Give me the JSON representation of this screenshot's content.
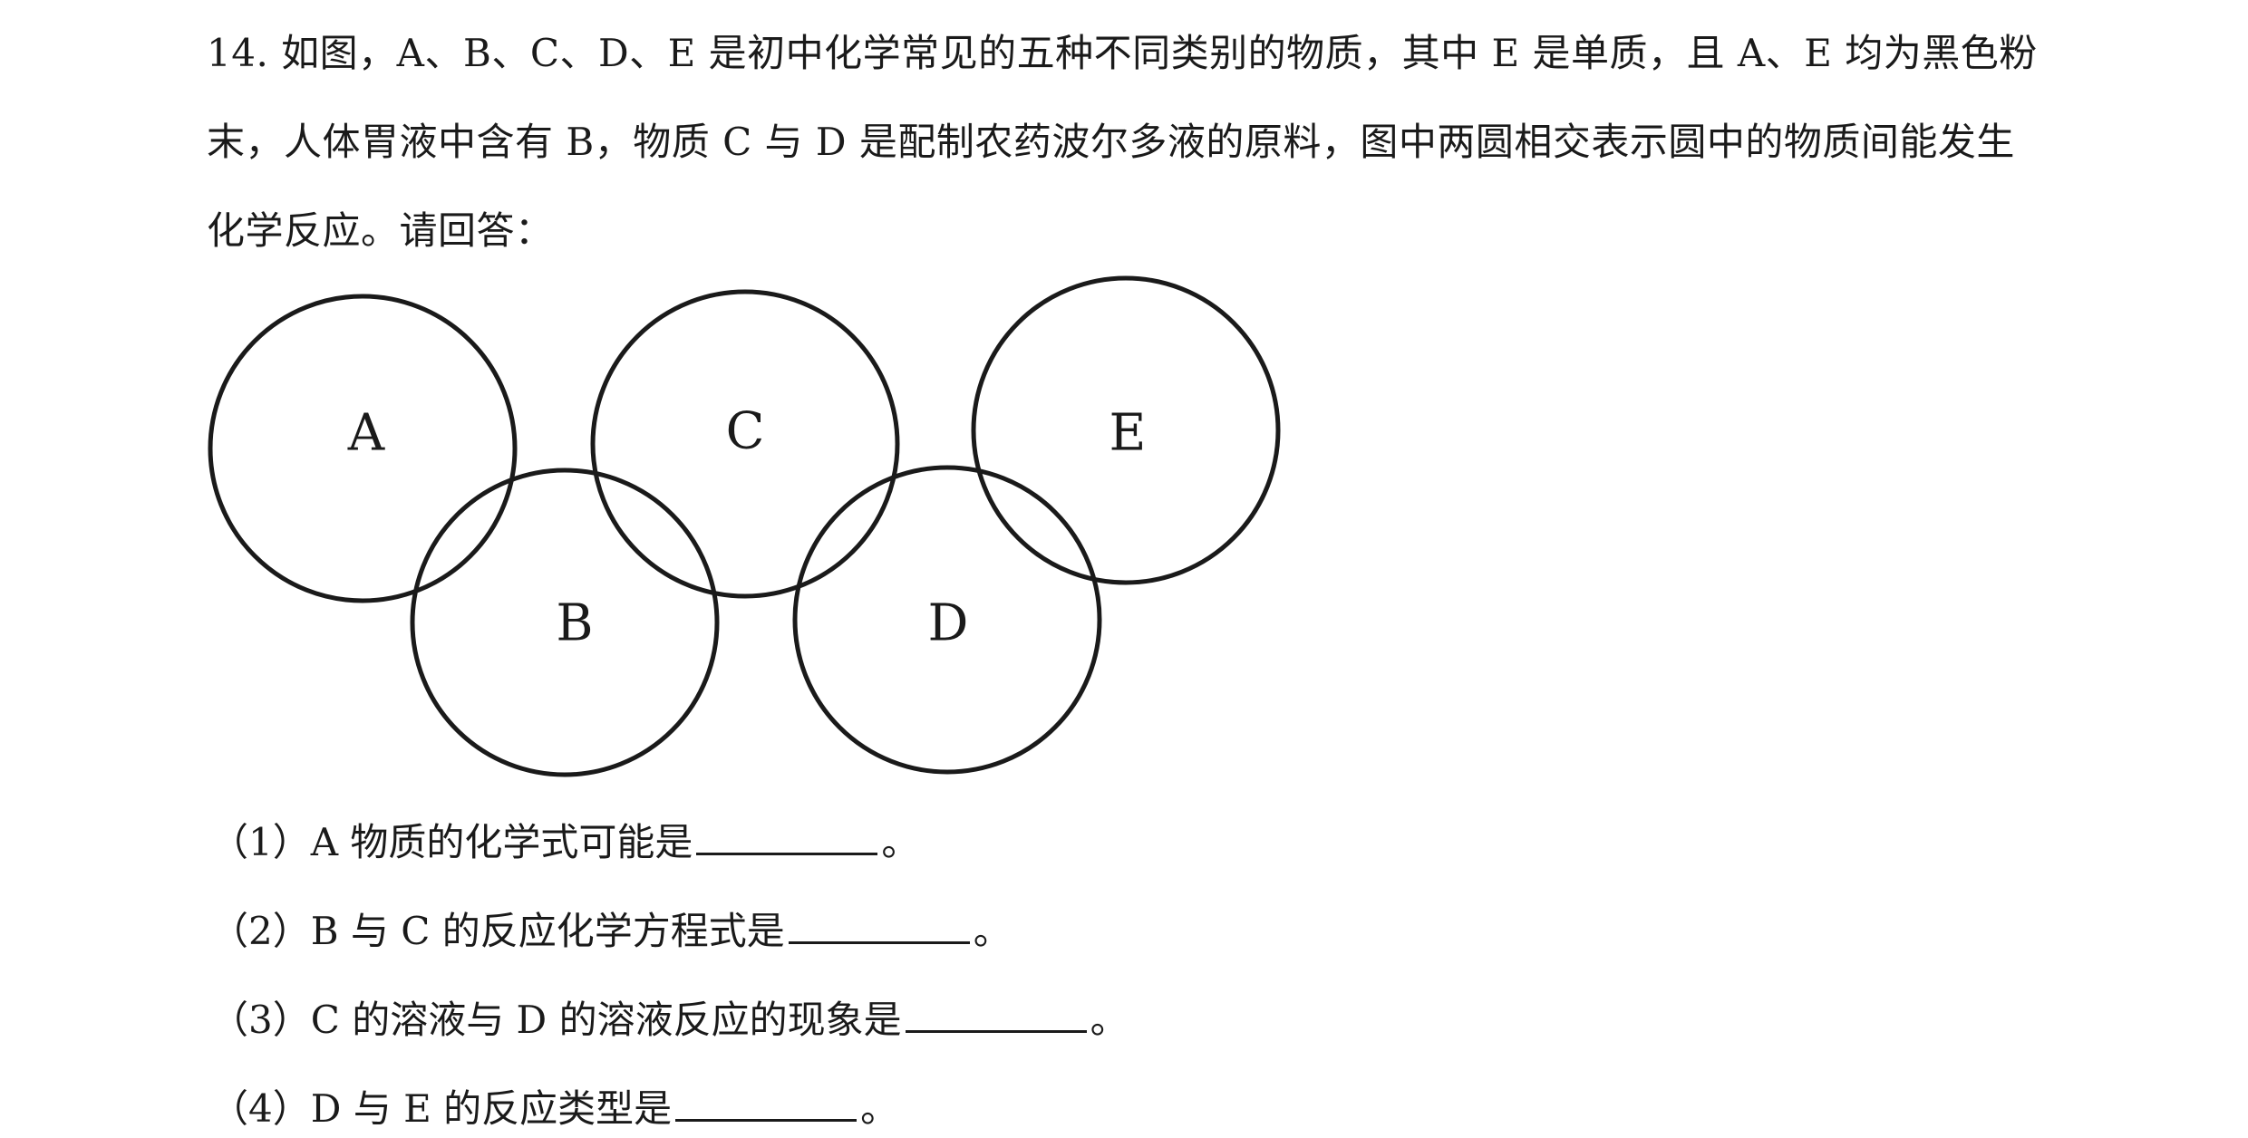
{
  "question": {
    "lines": [
      "14. 如图，A、B、C、D、E 是初中化学常见的五种不同类别的物质，其中 E 是单质，且 A、E 均为黑色粉",
      "末，人体胃液中含有 B，物质 C 与 D 是配制农药波尔多液的原料，图中两圆相交表示圆中的物质间能发生",
      "化学反应。请回答："
    ]
  },
  "diagram": {
    "circles": [
      {
        "label": "A",
        "row": "top"
      },
      {
        "label": "B",
        "row": "bottom"
      },
      {
        "label": "C",
        "row": "top"
      },
      {
        "label": "D",
        "row": "bottom"
      },
      {
        "label": "E",
        "row": "top"
      }
    ]
  },
  "sub_questions": [
    {
      "text": "（1）A 物质的化学式可能是",
      "end": "。"
    },
    {
      "text": "（2）B 与 C 的反应化学方程式是",
      "end": "。"
    },
    {
      "text": "（3）C 的溶液与 D 的溶液反应的现象是",
      "end": "。"
    },
    {
      "text": "（4）D 与 E 的反应类型是",
      "end": "。"
    }
  ]
}
